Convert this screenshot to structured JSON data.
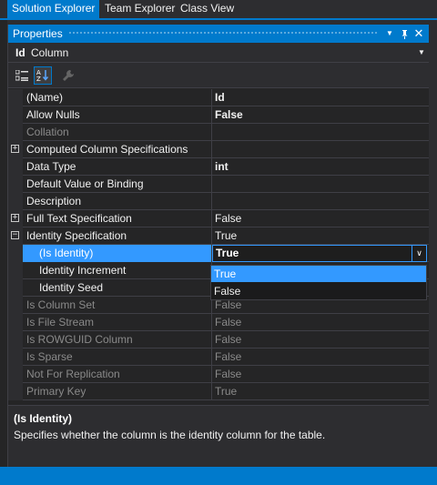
{
  "tabs": [
    "Solution Explorer",
    "Team Explorer",
    "Class View"
  ],
  "window": {
    "title": "Properties"
  },
  "object_selector": {
    "name": "Id",
    "type": "Column"
  },
  "toolbar": {
    "categorized_icon": "categorized-icon",
    "alphabetical_icon": "alphabetical-icon",
    "property_pages_icon": "wrench-icon"
  },
  "properties": [
    {
      "name": "(Name)",
      "value": "Id",
      "bold": true,
      "disabled": false,
      "expander": ""
    },
    {
      "name": "Allow Nulls",
      "value": "False",
      "bold": true,
      "disabled": false,
      "expander": ""
    },
    {
      "name": "Collation",
      "value": "",
      "bold": false,
      "disabled": true,
      "expander": ""
    },
    {
      "name": "Computed Column Specifications",
      "value": "",
      "bold": false,
      "disabled": false,
      "expander": "+"
    },
    {
      "name": "Data Type",
      "value": "int",
      "bold": true,
      "disabled": false,
      "expander": ""
    },
    {
      "name": "Default Value or Binding",
      "value": "",
      "bold": false,
      "disabled": false,
      "expander": ""
    },
    {
      "name": "Description",
      "value": "",
      "bold": false,
      "disabled": false,
      "expander": ""
    },
    {
      "name": "Full Text Specification",
      "value": "False",
      "bold": false,
      "disabled": false,
      "expander": "+"
    },
    {
      "name": "Identity Specification",
      "value": "True",
      "bold": false,
      "disabled": false,
      "expander": "−"
    },
    {
      "name": "(Is Identity)",
      "value": "True",
      "bold": true,
      "disabled": false,
      "expander": "",
      "child": true,
      "selected": true
    },
    {
      "name": "Identity Increment",
      "value": "",
      "bold": false,
      "disabled": false,
      "expander": "",
      "child": true
    },
    {
      "name": "Identity Seed",
      "value": "",
      "bold": false,
      "disabled": false,
      "expander": "",
      "child": true
    },
    {
      "name": "Is Column Set",
      "value": "False",
      "bold": false,
      "disabled": true,
      "expander": ""
    },
    {
      "name": "Is File Stream",
      "value": "False",
      "bold": false,
      "disabled": true,
      "expander": ""
    },
    {
      "name": "Is ROWGUID Column",
      "value": "False",
      "bold": false,
      "disabled": true,
      "expander": ""
    },
    {
      "name": "Is Sparse",
      "value": "False",
      "bold": false,
      "disabled": true,
      "expander": ""
    },
    {
      "name": "Not For Replication",
      "value": "False",
      "bold": false,
      "disabled": true,
      "expander": ""
    },
    {
      "name": "Primary Key",
      "value": "True",
      "bold": false,
      "disabled": true,
      "expander": ""
    }
  ],
  "dropdown": {
    "options": [
      "True",
      "False"
    ],
    "highlighted": "True"
  },
  "description": {
    "title": "(Is Identity)",
    "text": "Specifies whether the column is the identity column for the table."
  },
  "colors": {
    "accent": "#007acc",
    "selection": "#3399ff",
    "background": "#252526"
  }
}
